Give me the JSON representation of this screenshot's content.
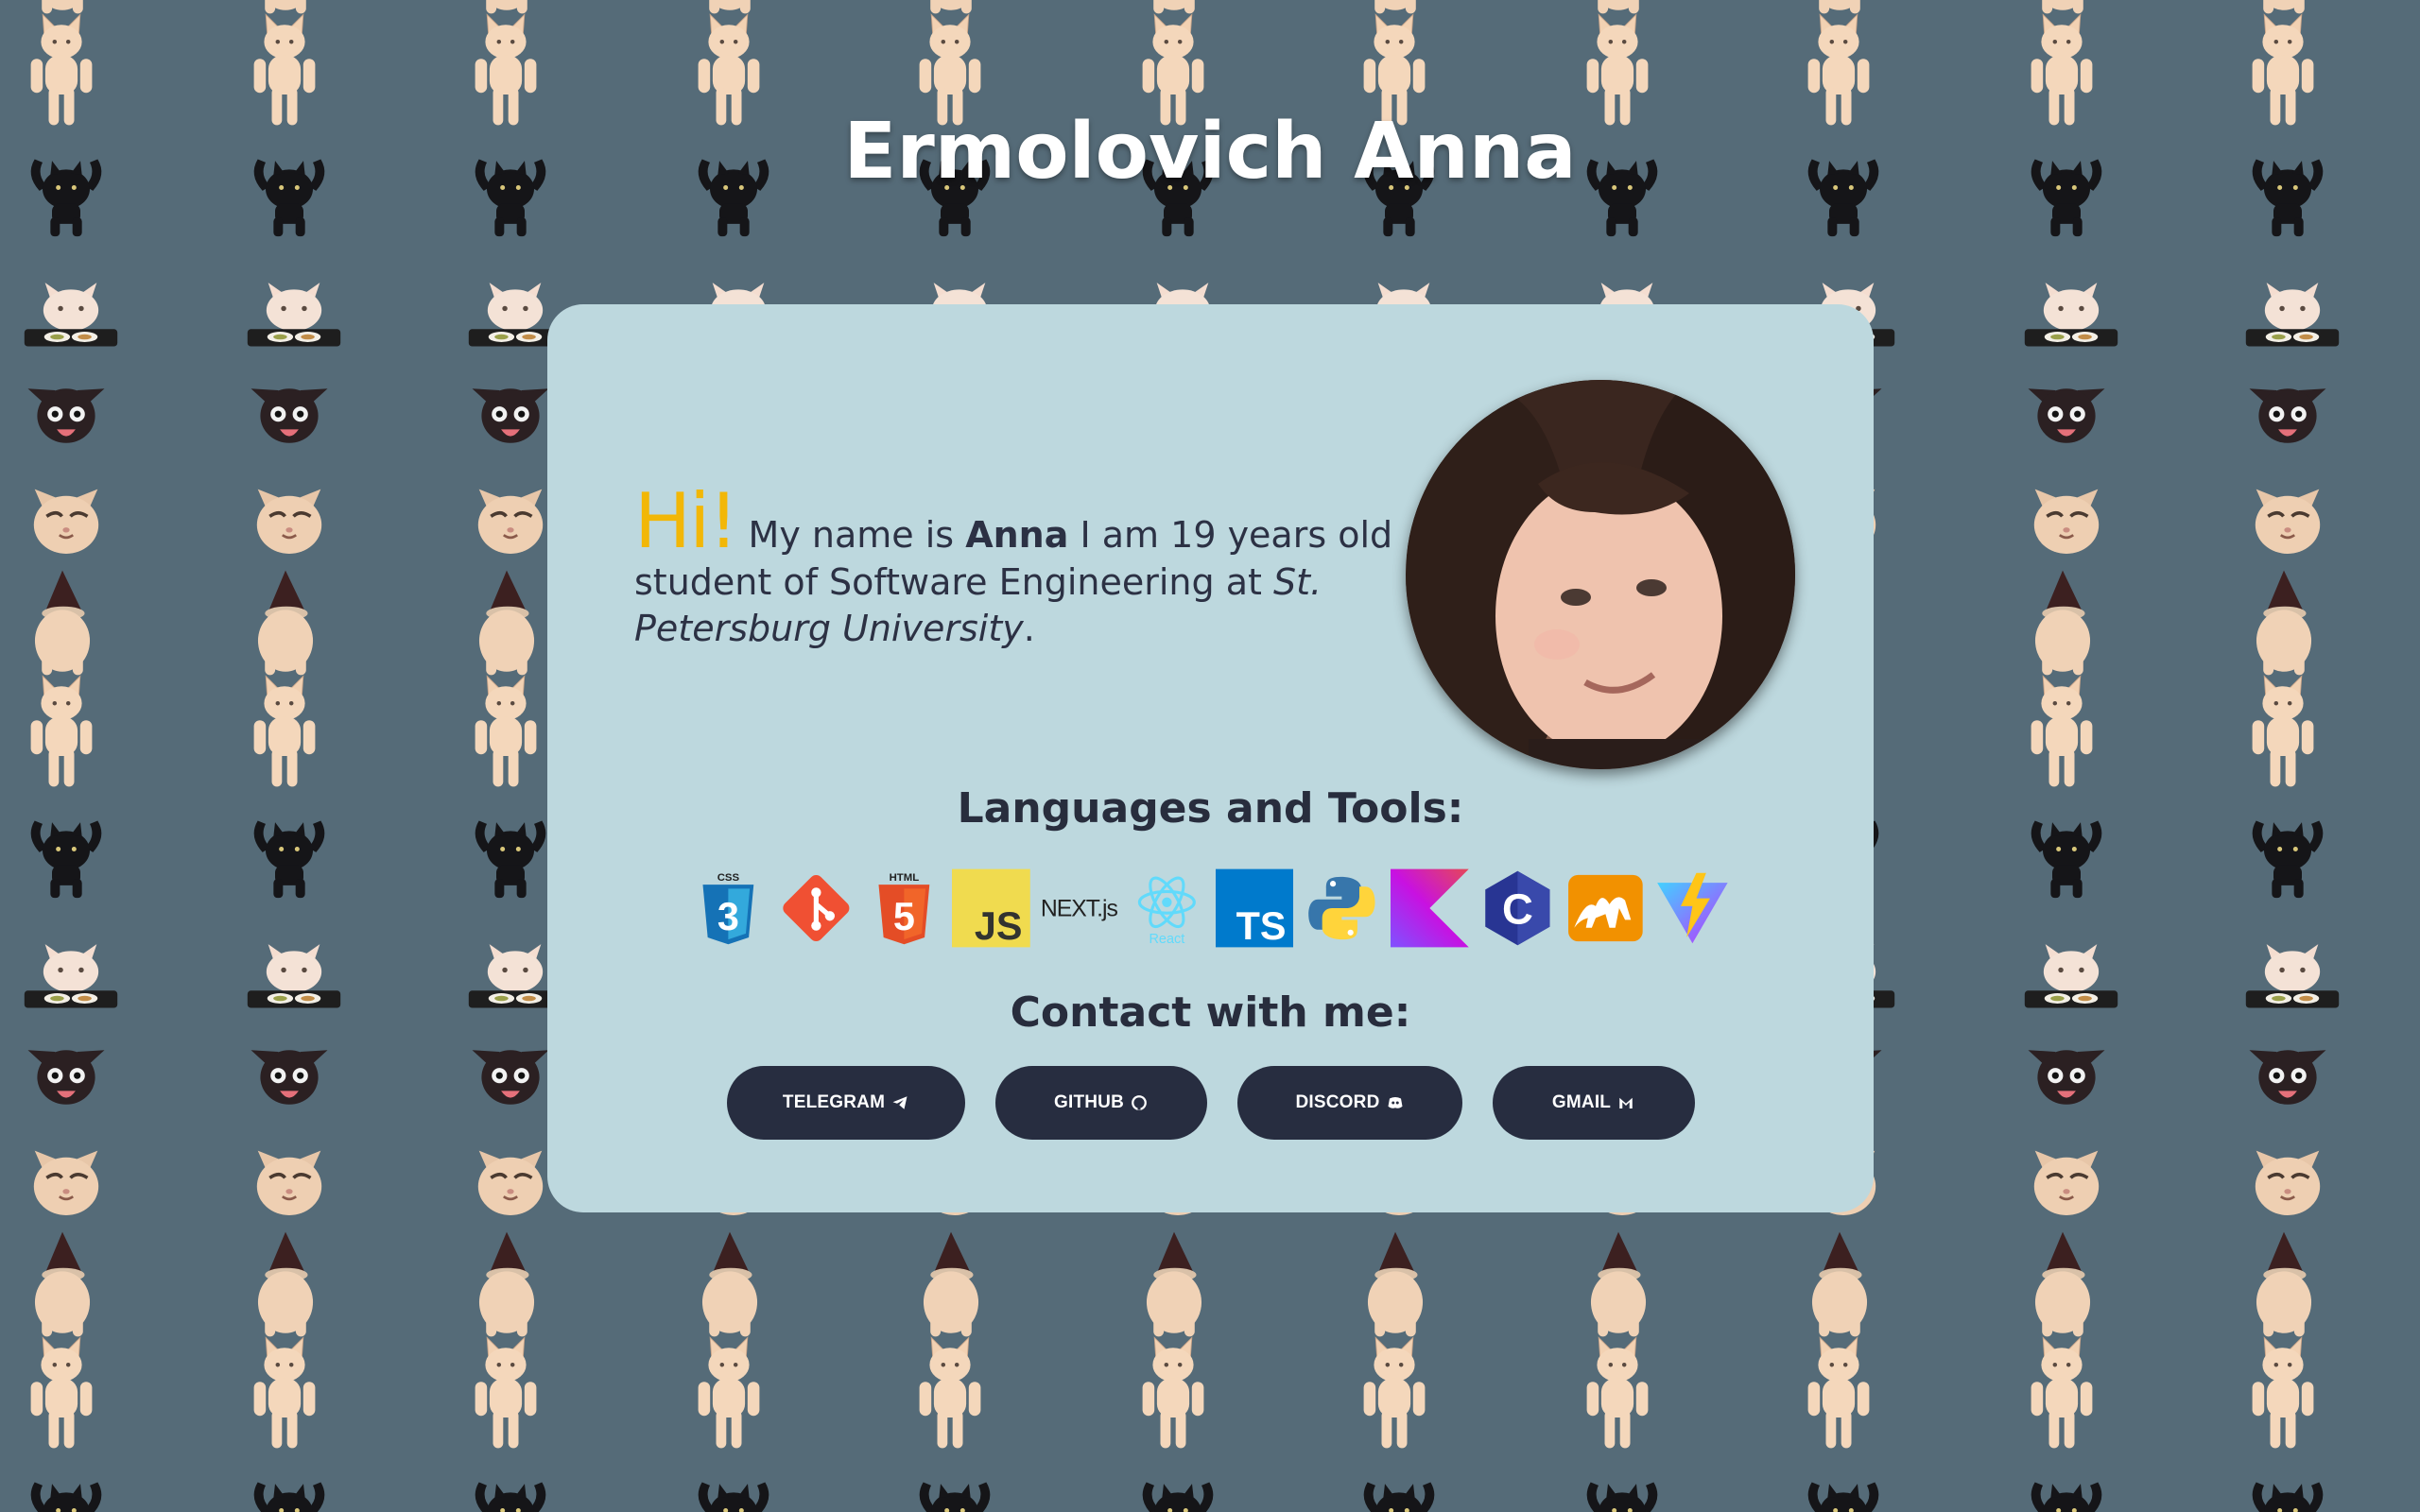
{
  "header": {
    "title": "Ermolovich Anna"
  },
  "intro": {
    "greeting": "Hi!",
    "text_before_name": "My name is",
    "name": "Anna",
    "text_after_name": "I am 19 years old student of Software Engineering at",
    "university": "St. Petersburg University",
    "end": "."
  },
  "tools": {
    "heading": "Languages and Tools:",
    "items": [
      {
        "name": "CSS3",
        "icon": "css3-icon",
        "label": "CSS"
      },
      {
        "name": "Git",
        "icon": "git-icon"
      },
      {
        "name": "HTML5",
        "icon": "html5-icon",
        "label": "HTML"
      },
      {
        "name": "JavaScript",
        "icon": "javascript-icon",
        "label": "JS"
      },
      {
        "name": "Next.js",
        "icon": "nextjs-icon",
        "label": "NEXT.js"
      },
      {
        "name": "React",
        "icon": "react-icon",
        "label": "React"
      },
      {
        "name": "TypeScript",
        "icon": "typescript-icon",
        "label": "TS"
      },
      {
        "name": "Python",
        "icon": "python-icon"
      },
      {
        "name": "Kotlin",
        "icon": "kotlin-icon"
      },
      {
        "name": "C",
        "icon": "c-icon",
        "label": "C"
      },
      {
        "name": "OCaml",
        "icon": "ocaml-icon"
      },
      {
        "name": "Vite",
        "icon": "vite-icon"
      }
    ]
  },
  "contact": {
    "heading": "Contact with me:",
    "buttons": [
      {
        "label": "TELEGRAM",
        "icon": "telegram-icon"
      },
      {
        "label": "GITHUB",
        "icon": "github-icon"
      },
      {
        "label": "DISCORD",
        "icon": "discord-icon"
      },
      {
        "label": "GMAIL",
        "icon": "gmail-icon"
      }
    ]
  },
  "colors": {
    "background": "#556b78",
    "card": "#bdd8de",
    "greeting": "#f2b707",
    "button": "#272d40",
    "text": "#2c3144"
  },
  "background_pattern": {
    "icon_names": [
      "standing-cat-icon",
      "black-cat-icon",
      "table-cat-icon",
      "chihuahua-icon",
      "cat-face-icon",
      "party-hat-cat-icon"
    ]
  }
}
